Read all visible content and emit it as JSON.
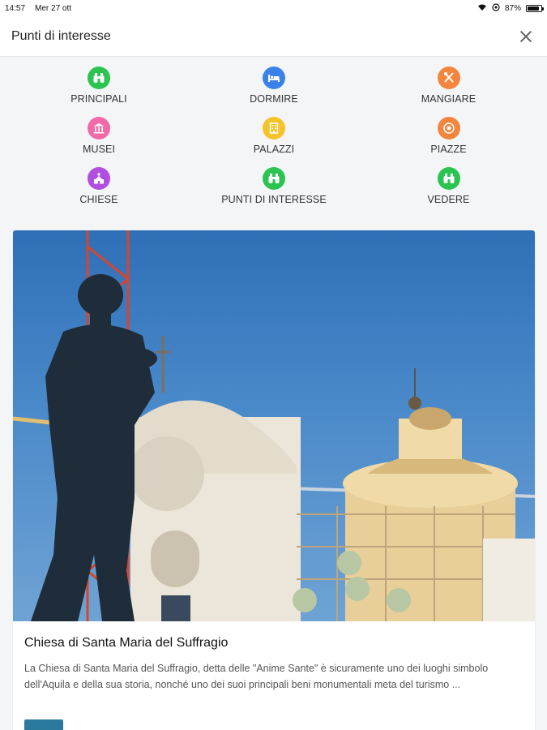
{
  "status_bar": {
    "time": "14:57",
    "date": "Mer 27 ott",
    "battery": "87%",
    "battery_level": 0.87
  },
  "header": {
    "title": "Punti di interesse",
    "close_icon": "close-icon"
  },
  "categories": [
    {
      "label": "PRINCIPALI",
      "icon": "binoculars-icon",
      "color": "#2bc451"
    },
    {
      "label": "DORMIRE",
      "icon": "bed-icon",
      "color": "#3b82e8"
    },
    {
      "label": "MANGIARE",
      "icon": "utensils-icon",
      "color": "#f4853d"
    },
    {
      "label": "MUSEI",
      "icon": "museum-icon",
      "color": "#f06aa8"
    },
    {
      "label": "PALAZZI",
      "icon": "building-icon",
      "color": "#f5c32a"
    },
    {
      "label": "PIAZZE",
      "icon": "target-icon",
      "color": "#f4853d"
    },
    {
      "label": "CHIESE",
      "icon": "church-icon",
      "color": "#b04fe0"
    },
    {
      "label": "PUNTI DI INTERESSE",
      "icon": "binoculars-icon",
      "color": "#2bc451"
    },
    {
      "label": "VEDERE",
      "icon": "binoculars-icon",
      "color": "#2bc451"
    }
  ],
  "card": {
    "title": "Chiesa di Santa Maria del Suffragio",
    "text": "La Chiesa di Santa Maria del Suffragio, detta delle \"Anime Sante\" è sicuramente uno dei luoghi simbolo dell'Aquila e della sua storia, nonché uno dei suoi principali beni monumentali meta del turismo ..."
  }
}
